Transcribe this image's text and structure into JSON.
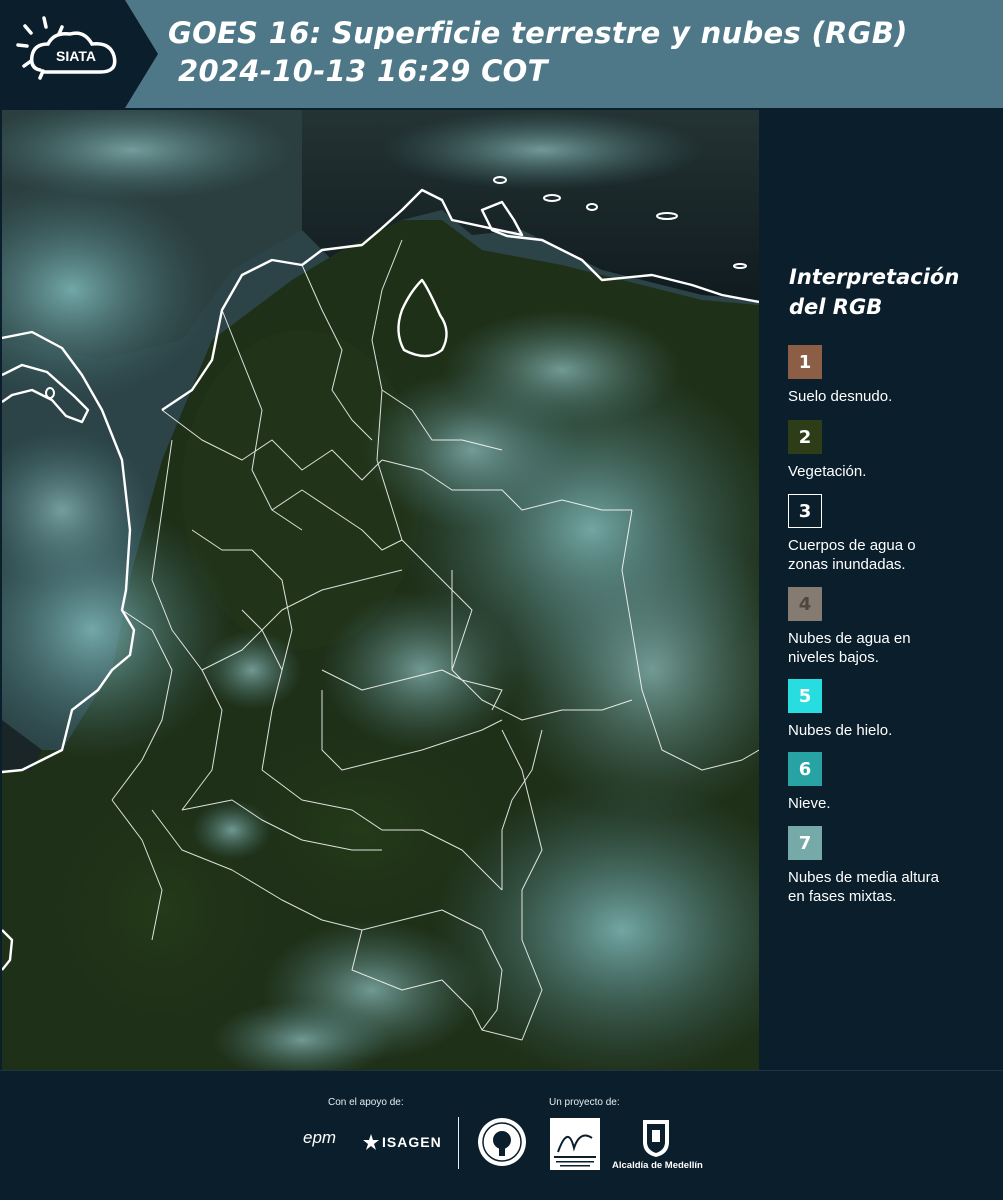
{
  "header": {
    "logo_text": "SIATA",
    "title_line1": "GOES 16: Superficie terrestre y nubes (RGB)",
    "title_line2": "2024-10-13 16:29 COT"
  },
  "legend": {
    "title_line1": "Interpretación",
    "title_line2": "del RGB",
    "items": [
      {
        "number": "1",
        "label_lines": [
          "Suelo desnudo."
        ],
        "color": "#8b5e45"
      },
      {
        "number": "2",
        "label_lines": [
          "Vegetación."
        ],
        "color": "#2d3d18"
      },
      {
        "number": "3",
        "label_lines": [
          "Cuerpos de agua o",
          "zonas inundadas."
        ],
        "color": "#0b1e2b",
        "border": "#ffffff"
      },
      {
        "number": "4",
        "label_lines": [
          "Nubes de agua en",
          "niveles bajos."
        ],
        "color": "#857b70"
      },
      {
        "number": "5",
        "label_lines": [
          "Nubes de hielo."
        ],
        "color": "#27dde0"
      },
      {
        "number": "6",
        "label_lines": [
          "Nieve."
        ],
        "color": "#27a3a4"
      },
      {
        "number": "7",
        "label_lines": [
          "Nubes de media altura",
          "en fases mixtas."
        ],
        "color": "#76aaa9"
      }
    ]
  },
  "footer": {
    "support_caption": "Con el apoyo de:",
    "project_caption": "Un proyecto de:",
    "sponsor_1": "epm",
    "sponsor_2": "ISAGEN",
    "partner_logo_text": "Área METROPOLITANA Valle de Aburrá",
    "city_caption": "Alcaldía de Medellín"
  },
  "colors": {
    "header_bg": "#4e7888",
    "logo_panel_bg": "#0b1e2b",
    "page_bg": "#0b1e2b",
    "vegetation_green": "#1f2e15",
    "cloud_cyan": "#6fa2a4",
    "border_white": "#ffffff"
  },
  "icons": [
    "siata-sun-cloud-icon",
    "vigilancia-seal-icon",
    "area-metropolitana-logo-icon",
    "medellin-shield-icon",
    "isagen-star-icon"
  ]
}
